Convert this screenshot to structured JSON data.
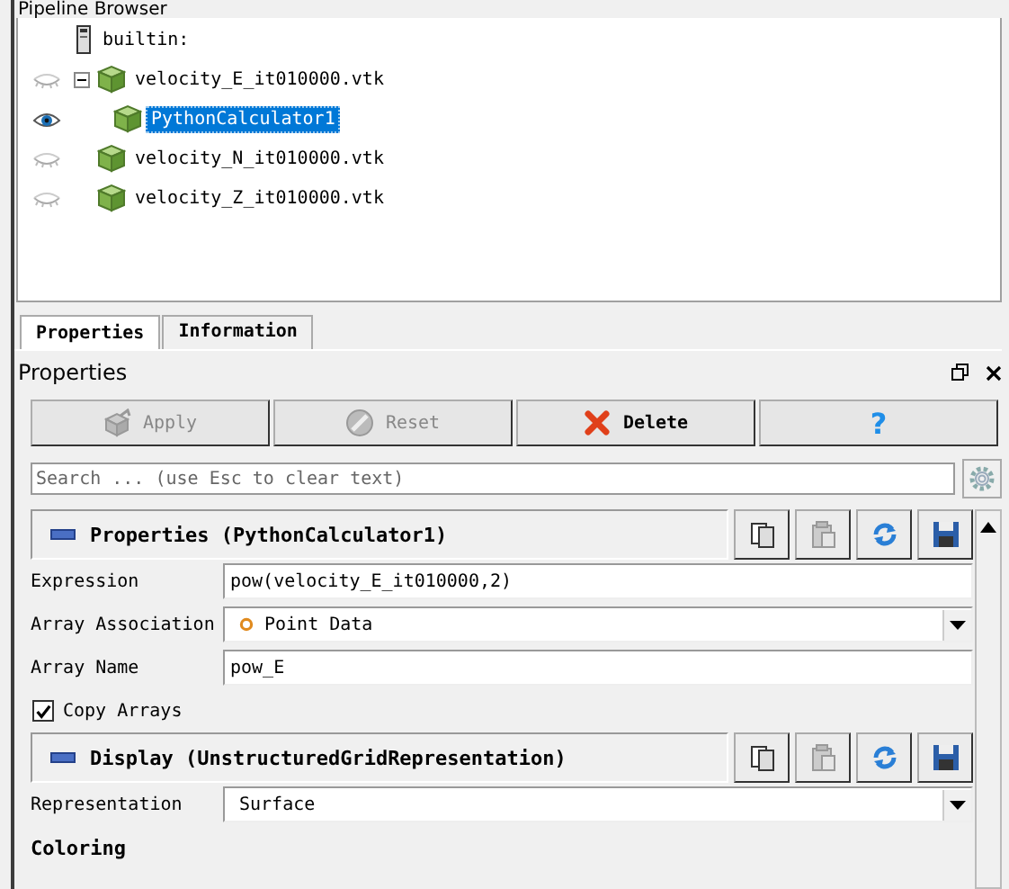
{
  "pipeline_browser": {
    "title": "Pipeline Browser",
    "tree": [
      {
        "label": "builtin:",
        "kind": "server",
        "children": [
          {
            "label": "velocity_E_it010000.vtk",
            "kind": "source",
            "visible": false,
            "selected": false,
            "expanded": true,
            "children": [
              {
                "label": "PythonCalculator1",
                "kind": "source",
                "visible": true,
                "selected": true
              }
            ]
          },
          {
            "label": "velocity_N_it010000.vtk",
            "kind": "source",
            "visible": false,
            "selected": false
          },
          {
            "label": "velocity_Z_it010000.vtk",
            "kind": "source",
            "visible": false,
            "selected": false
          }
        ]
      }
    ]
  },
  "tabs": [
    {
      "label": "Properties",
      "selected": true
    },
    {
      "label": "Information",
      "selected": false
    }
  ],
  "properties_panel": {
    "title": "Properties",
    "buttons": [
      {
        "label": "Apply",
        "kind": "apply",
        "disabled": true
      },
      {
        "label": "Reset",
        "kind": "reset",
        "disabled": true
      },
      {
        "label": "Delete",
        "kind": "delete",
        "disabled": false
      },
      {
        "label": "?",
        "kind": "help",
        "disabled": false
      }
    ],
    "search": {
      "placeholder": "Search ... (use Esc to clear text)"
    },
    "sections": [
      {
        "title": "Properties (PythonCalculator1)",
        "fields": [
          {
            "kind": "text",
            "label": "Expression",
            "value": "pow(velocity_E_it010000,2)"
          },
          {
            "kind": "dropdown",
            "label": "Array Association",
            "value": "Point Data",
            "marker": true
          },
          {
            "kind": "text",
            "label": "Array Name",
            "value": "pow_E"
          },
          {
            "kind": "checkbox",
            "label": "Copy Arrays",
            "checked": true
          }
        ]
      },
      {
        "title": "Display (UnstructuredGridRepresentation)",
        "fields": [
          {
            "kind": "dropdown",
            "label": "Representation",
            "value": "Surface"
          },
          {
            "kind": "subheading",
            "label": "Coloring"
          }
        ]
      }
    ]
  }
}
